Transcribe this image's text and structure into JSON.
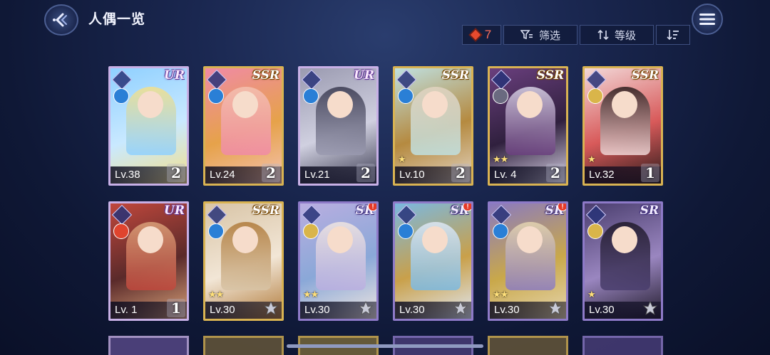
{
  "header": {
    "title": "人偶一览",
    "back_icon": "back-arrow-icon",
    "menu_icon": "hamburger-menu-icon"
  },
  "toolbar": {
    "count": "7",
    "filter_label": "筛选",
    "level_sort_label": "等级",
    "gem_color": "#e64a2e"
  },
  "cards": [
    {
      "rarity": "UR",
      "level": "Lv.38",
      "tier": "2",
      "stars": "",
      "element": "water",
      "alert": false,
      "palette": [
        "#8fd0ff",
        "#f4e08a",
        "#c9e9ff"
      ]
    },
    {
      "rarity": "SSR",
      "level": "Lv.24",
      "tier": "2",
      "stars": "",
      "element": "water",
      "alert": false,
      "palette": [
        "#f08aa6",
        "#f4c2b0",
        "#e6a24a"
      ]
    },
    {
      "rarity": "UR",
      "level": "Lv.21",
      "tier": "2",
      "stars": "",
      "element": "water",
      "alert": false,
      "palette": [
        "#9a9ab0",
        "#3a3a50",
        "#d0d0e0"
      ]
    },
    {
      "rarity": "SSR",
      "level": "Lv.10",
      "tier": "2",
      "stars": "★",
      "element": "water",
      "alert": false,
      "palette": [
        "#bfe0e0",
        "#e2d3c0",
        "#b58a40"
      ]
    },
    {
      "rarity": "SSR",
      "level": "Lv. 4",
      "tier": "2",
      "stars": "★★",
      "element": "dark",
      "alert": false,
      "palette": [
        "#6a3f7e",
        "#d9d4e6",
        "#30203e"
      ]
    },
    {
      "rarity": "SSR",
      "level": "Lv.32",
      "tier": "1",
      "stars": "★",
      "element": "light",
      "alert": false,
      "palette": [
        "#f2d8d8",
        "#2a1a1a",
        "#d85a5a"
      ]
    },
    {
      "rarity": "UR",
      "level": "Lv. 1",
      "tier": "1",
      "stars": "",
      "element": "fire",
      "alert": false,
      "palette": [
        "#c0473c",
        "#d9a27a",
        "#5a2a2a"
      ]
    },
    {
      "rarity": "SSR",
      "level": "Lv.30",
      "tier": "",
      "stars": "★★",
      "element": "water",
      "alert": false,
      "palette": [
        "#d8c4a6",
        "#b07a3a",
        "#f2e6d6"
      ]
    },
    {
      "rarity": "SR",
      "level": "Lv.30",
      "tier": "",
      "stars": "★★",
      "element": "light",
      "alert": true,
      "palette": [
        "#b9aee0",
        "#f0e6e0",
        "#8aa8d8"
      ]
    },
    {
      "rarity": "SR",
      "level": "Lv.30",
      "tier": "",
      "stars": "",
      "element": "water",
      "alert": true,
      "palette": [
        "#7ab8e0",
        "#e0e8f4",
        "#c9a04a"
      ]
    },
    {
      "rarity": "SR",
      "level": "Lv.30",
      "tier": "",
      "stars": "★★",
      "element": "water",
      "alert": true,
      "palette": [
        "#8a7ac0",
        "#e6d6b0",
        "#c9a84a"
      ]
    },
    {
      "rarity": "SR",
      "level": "Lv.30",
      "tier": "",
      "stars": "★",
      "element": "light",
      "alert": false,
      "palette": [
        "#4a3e6e",
        "#201a2a",
        "#9a86c0"
      ]
    }
  ]
}
